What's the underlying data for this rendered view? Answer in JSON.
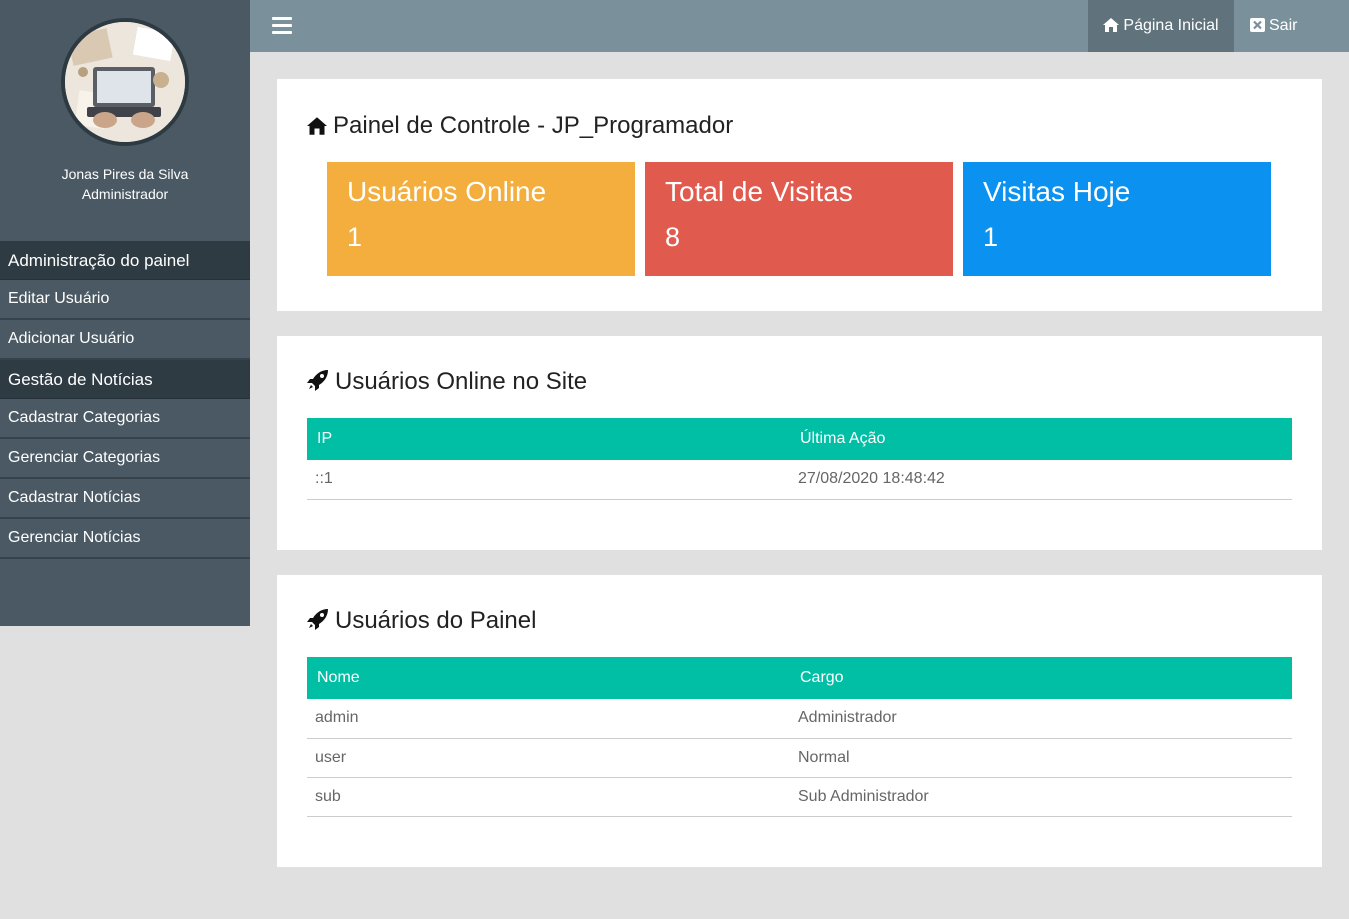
{
  "sidebar": {
    "user_name": "Jonas Pires da Silva",
    "user_role": "Administrador",
    "sections": [
      {
        "label": "Administração do painel",
        "items": [
          "Editar Usuário",
          "Adicionar Usuário"
        ]
      },
      {
        "label": "Gestão de Notícias",
        "items": [
          "Cadastrar Categorias",
          "Gerenciar Categorias",
          "Cadastrar Notícias",
          "Gerenciar Notícias"
        ]
      }
    ]
  },
  "topbar": {
    "home_label": "Página Inicial",
    "exit_label": "Sair"
  },
  "dashboard": {
    "title": "Painel de Controle - JP_Programador",
    "stats": [
      {
        "label": "Usuários Online",
        "value": "1",
        "color": "#f3ae3d"
      },
      {
        "label": "Total de Visitas",
        "value": "8",
        "color": "#e15a4e"
      },
      {
        "label": "Visitas Hoje",
        "value": "1",
        "color": "#0b91f0"
      }
    ]
  },
  "online_users": {
    "title": "Usuários Online no Site",
    "columns": [
      "IP",
      "Última Ação"
    ],
    "rows": [
      [
        "::1",
        "27/08/2020 18:48:42"
      ]
    ]
  },
  "panel_users": {
    "title": "Usuários do Painel",
    "columns": [
      "Nome",
      "Cargo"
    ],
    "rows": [
      [
        "admin",
        "Administrador"
      ],
      [
        "user",
        "Normal"
      ],
      [
        "sub",
        "Sub Administrador"
      ]
    ]
  },
  "colors": {
    "sidebar": "#4a5963",
    "topbar": "#7a909b",
    "table_header": "#00bfa5"
  },
  "icons": [
    "menu-icon",
    "home-icon",
    "close-box-icon",
    "rocket-icon"
  ]
}
